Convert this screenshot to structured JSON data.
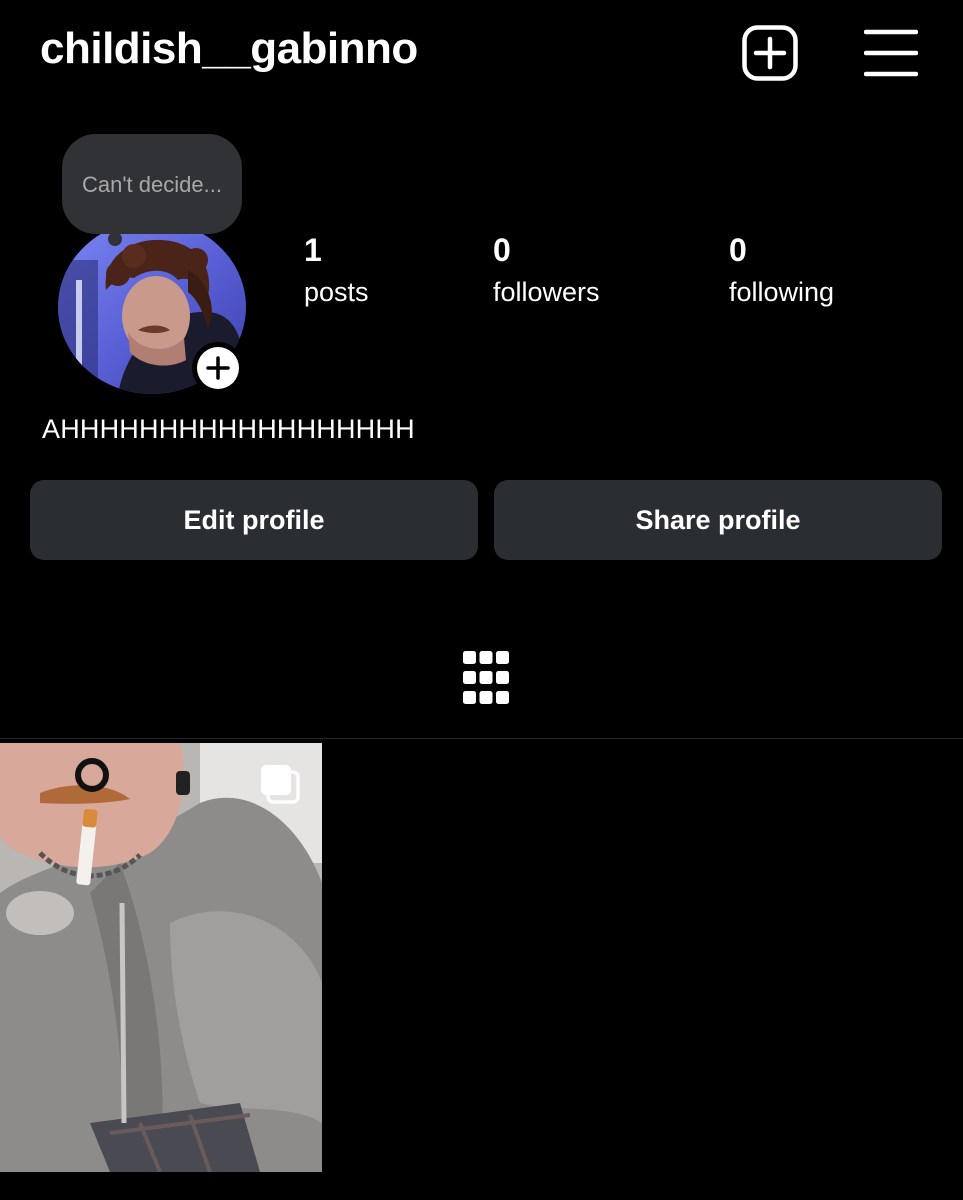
{
  "header": {
    "username": "childish__gabinno",
    "create_icon": "plus-square-icon",
    "menu_icon": "hamburger-menu-icon"
  },
  "note": {
    "text": "Can't decide..."
  },
  "stats": {
    "posts": {
      "count": "1",
      "label": "posts"
    },
    "followers": {
      "count": "0",
      "label": "followers"
    },
    "following": {
      "count": "0",
      "label": "following"
    }
  },
  "bio": "AHHHHHHHHHHHHHHHHHH",
  "actions": {
    "edit_label": "Edit profile",
    "share_label": "Share profile"
  },
  "tabs": {
    "grid_icon": "grid-icon"
  },
  "posts": [
    {
      "type": "carousel",
      "icon": "multiple-images-icon"
    }
  ],
  "colors": {
    "background": "#000000",
    "button_bg": "#2a2d32",
    "note_bg": "#303235",
    "text": "#ffffff",
    "note_text": "#a8a8a8"
  }
}
